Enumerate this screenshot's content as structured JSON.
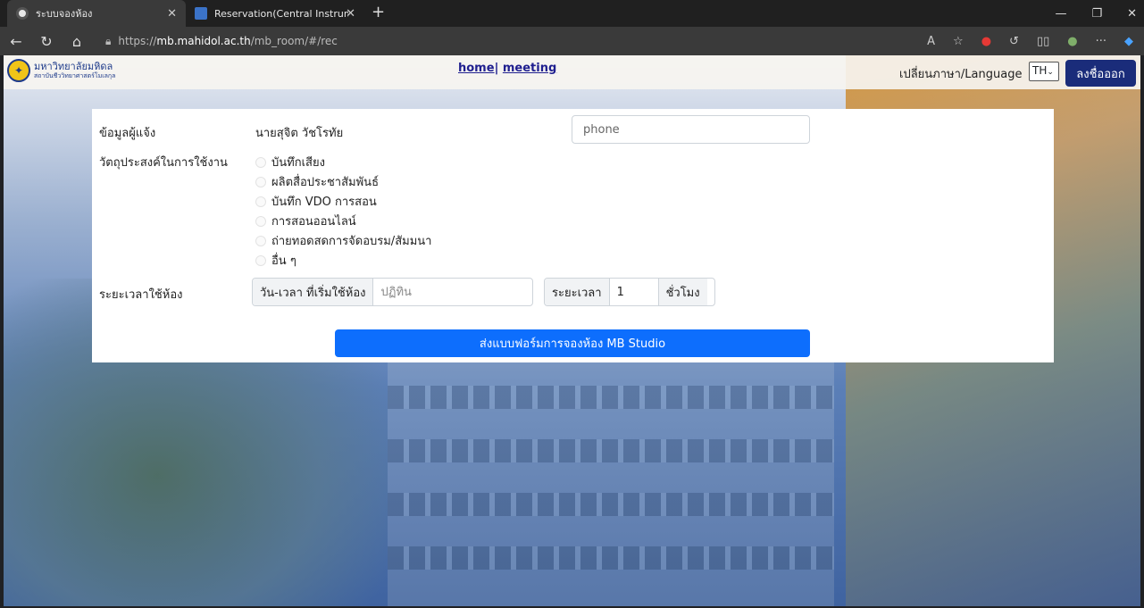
{
  "browser": {
    "tabs": [
      {
        "label": "ระบบจองห้อง",
        "active": true,
        "favicon_color": "#e8e8e8"
      },
      {
        "label": "Reservation(Central Instrument)",
        "active": false,
        "favicon_color": "#3b73c8"
      }
    ],
    "new_tab": "+",
    "url_prefix": "https://",
    "url_host": "mb.mahidol.ac.th",
    "url_path": "/mb_room/#/rec"
  },
  "navbar": {
    "logo_title": "มหาวิทยาลัยมหิดล",
    "logo_subtitle": "สถาบันชีววิทยาศาสตร์โมเลกุล",
    "home_link": "home",
    "separator": "|",
    "meeting_link": "meeting",
    "language_label": "เปลี่ยนภาษา/Language",
    "language_value": "TH",
    "logout_label": "ลงชื่อออก"
  },
  "form": {
    "reporter_label": "ข้อมูลผู้แจ้ง",
    "reporter_name": "นายสุจิต วัชโรทัย",
    "phone_placeholder": "phone",
    "purpose_label": "วัตถุประสงค์ในการใช้งาน",
    "purpose_options": [
      "บันทึกเสียง",
      "ผลิตสื่อประชาสัมพันธ์",
      "บันทึก VDO การสอน",
      "การสอนออนไลน์",
      "ถ่ายทอดสดการจัดอบรม/สัมมนา",
      "อื่น ๆ"
    ],
    "duration_label": "ระยะเวลาใช้ห้อง",
    "start_label": "วัน-เวลา ที่เริ่มใช้ห้อง",
    "start_placeholder": "ปฏิทิน",
    "length_label": "ระยะเวลา",
    "length_value": "1",
    "hours_label": "ชั่วโมง",
    "submit_label": "ส่งแบบฟอร์มการจองห้อง MB Studio"
  },
  "colors": {
    "submit": "#0d6efd",
    "logout": "#1a2c7a",
    "nav_link": "#1f1f8f"
  }
}
